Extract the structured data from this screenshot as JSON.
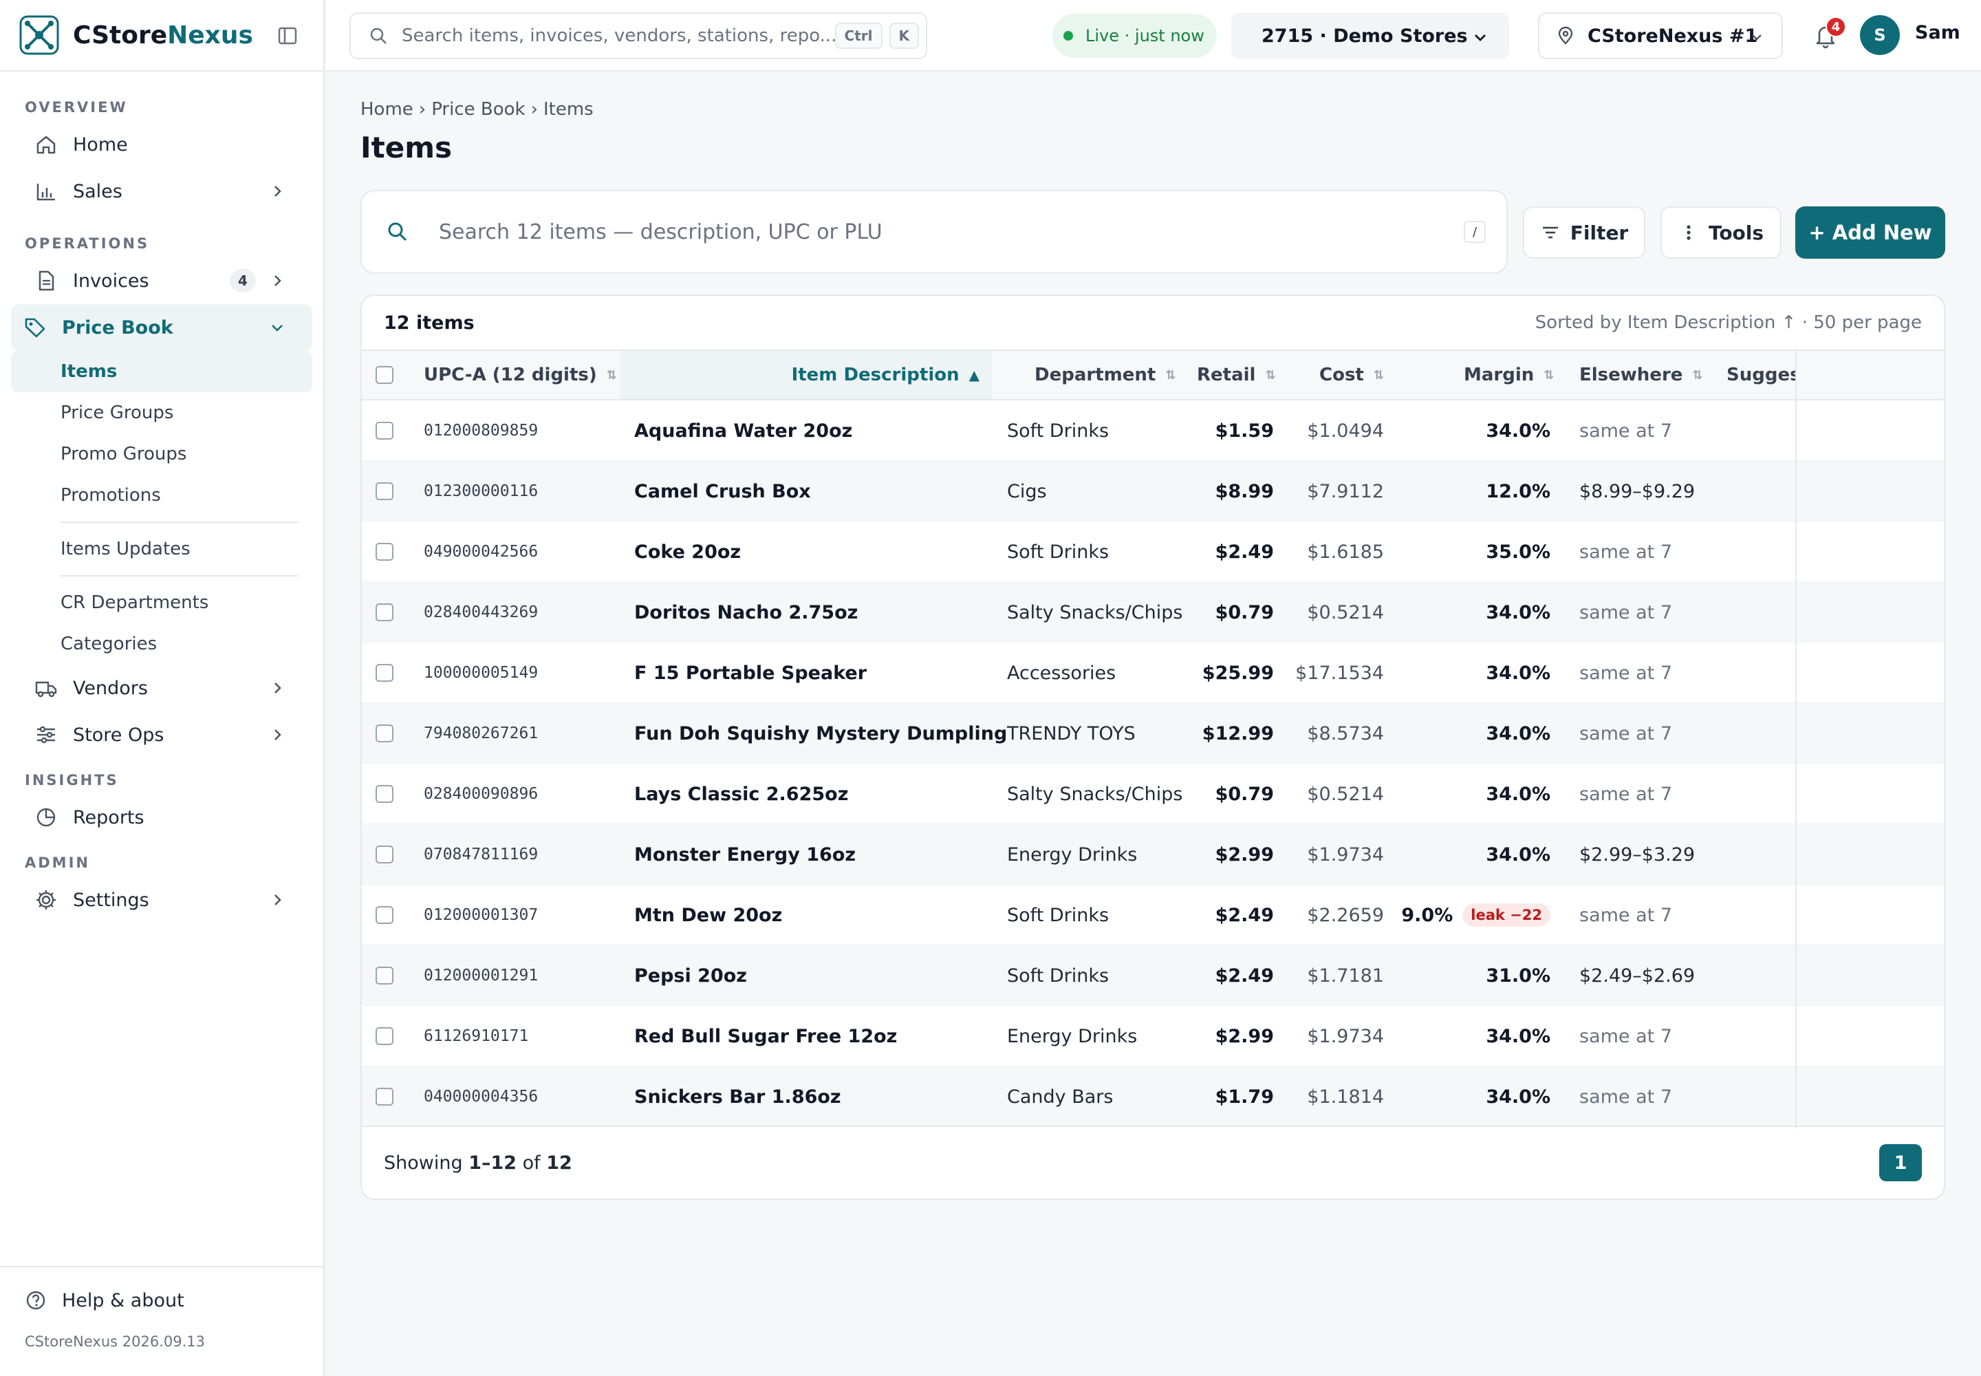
{
  "app": {
    "name_main": "CStore",
    "name_accent": "Nexus",
    "version": "CStoreNexus 2026.09.13"
  },
  "sidebar": {
    "sections": {
      "overview": "OVERVIEW",
      "operations": "OPERATIONS",
      "insights": "INSIGHTS",
      "admin": "ADMIN"
    },
    "home": "Home",
    "sales": "Sales",
    "invoices": "Invoices",
    "invoices_count": "4",
    "price_book": "Price Book",
    "price_book_sub": [
      "Items",
      "Price Groups",
      "Promo Groups",
      "Promotions",
      "Items Updates",
      "CR Departments",
      "Categories"
    ],
    "vendors": "Vendors",
    "store_ops": "Store Ops",
    "reports": "Reports",
    "settings": "Settings",
    "help": "Help & about"
  },
  "topbar": {
    "search_placeholder": "Search items, invoices, vendors, stations, repo...",
    "kbd_ctrl": "Ctrl",
    "kbd_k": "K",
    "live_status": "Live · just now",
    "org_select": "2715 · Demo Stores",
    "store_select": "CStoreNexus #1",
    "notifications_count": "4",
    "user_initial": "S",
    "user_name": "Sam"
  },
  "page": {
    "breadcrumb": [
      "Home",
      "Price Book",
      "Items"
    ],
    "title": "Items",
    "search_placeholder": "Search 12 items — description, UPC or PLU",
    "search_shortcut": "/",
    "filter_label": "Filter",
    "tools_label": "Tools",
    "add_label": "+ Add New"
  },
  "table": {
    "count_label": "12 items",
    "sort_info": "Sorted by Item Description ↑ · 50 per page",
    "columns": {
      "upc": "UPC-A (12 digits)",
      "description": "Item Description",
      "department": "Department",
      "retail": "Retail",
      "cost": "Cost",
      "margin": "Margin",
      "elsewhere": "Elsewhere",
      "suggested": "Sugges"
    },
    "sort_indicator": "⇅",
    "sorted_indicator": "▲",
    "rows": [
      {
        "upc": "012000809859",
        "desc": "Aquafina Water 20oz",
        "dept": "Soft Drinks",
        "retail": "$1.59",
        "cost": "$1.0494",
        "margin": "34.0%",
        "else": "same at 7"
      },
      {
        "upc": "012300000116",
        "desc": "Camel Crush Box",
        "dept": "Cigs",
        "retail": "$8.99",
        "cost": "$7.9112",
        "margin": "12.0%",
        "else": "$8.99–$9.29"
      },
      {
        "upc": "049000042566",
        "desc": "Coke 20oz",
        "dept": "Soft Drinks",
        "retail": "$2.49",
        "cost": "$1.6185",
        "margin": "35.0%",
        "else": "same at 7"
      },
      {
        "upc": "028400443269",
        "desc": "Doritos Nacho 2.75oz",
        "dept": "Salty Snacks/Chips",
        "retail": "$0.79",
        "cost": "$0.5214",
        "margin": "34.0%",
        "else": "same at 7"
      },
      {
        "upc": "100000005149",
        "desc": "F 15 Portable Speaker",
        "dept": "Accessories",
        "retail": "$25.99",
        "cost": "$17.1534",
        "margin": "34.0%",
        "else": "same at 7"
      },
      {
        "upc": "794080267261",
        "desc": "Fun Doh Squishy Mystery Dumpling",
        "dept": "TRENDY TOYS",
        "retail": "$12.99",
        "cost": "$8.5734",
        "margin": "34.0%",
        "else": "same at 7"
      },
      {
        "upc": "028400090896",
        "desc": "Lays Classic 2.625oz",
        "dept": "Salty Snacks/Chips",
        "retail": "$0.79",
        "cost": "$0.5214",
        "margin": "34.0%",
        "else": "same at 7"
      },
      {
        "upc": "070847811169",
        "desc": "Monster Energy 16oz",
        "dept": "Energy Drinks",
        "retail": "$2.99",
        "cost": "$1.9734",
        "margin": "34.0%",
        "else": "$2.99–$3.29"
      },
      {
        "upc": "012000001307",
        "desc": "Mtn Dew 20oz",
        "dept": "Soft Drinks",
        "retail": "$2.49",
        "cost": "$2.2659",
        "margin": "9.0%",
        "leak": "leak −22",
        "else": "same at 7"
      },
      {
        "upc": "012000001291",
        "desc": "Pepsi 20oz",
        "dept": "Soft Drinks",
        "retail": "$2.49",
        "cost": "$1.7181",
        "margin": "31.0%",
        "else": "$2.49–$2.69"
      },
      {
        "upc": "61126910171",
        "desc": "Red Bull Sugar Free 12oz",
        "dept": "Energy Drinks",
        "retail": "$2.99",
        "cost": "$1.9734",
        "margin": "34.0%",
        "else": "same at 7"
      },
      {
        "upc": "040000004356",
        "desc": "Snickers Bar 1.86oz",
        "dept": "Candy Bars",
        "retail": "$1.79",
        "cost": "$1.1814",
        "margin": "34.0%",
        "else": "same at 7"
      }
    ],
    "footer": {
      "showing_prefix": "Showing ",
      "range": "1–12",
      "of": " of ",
      "total": "12",
      "page": "1"
    }
  },
  "colors": {
    "accent": "#0f6b78",
    "danger": "#dc2626",
    "live": "#16a34a"
  }
}
